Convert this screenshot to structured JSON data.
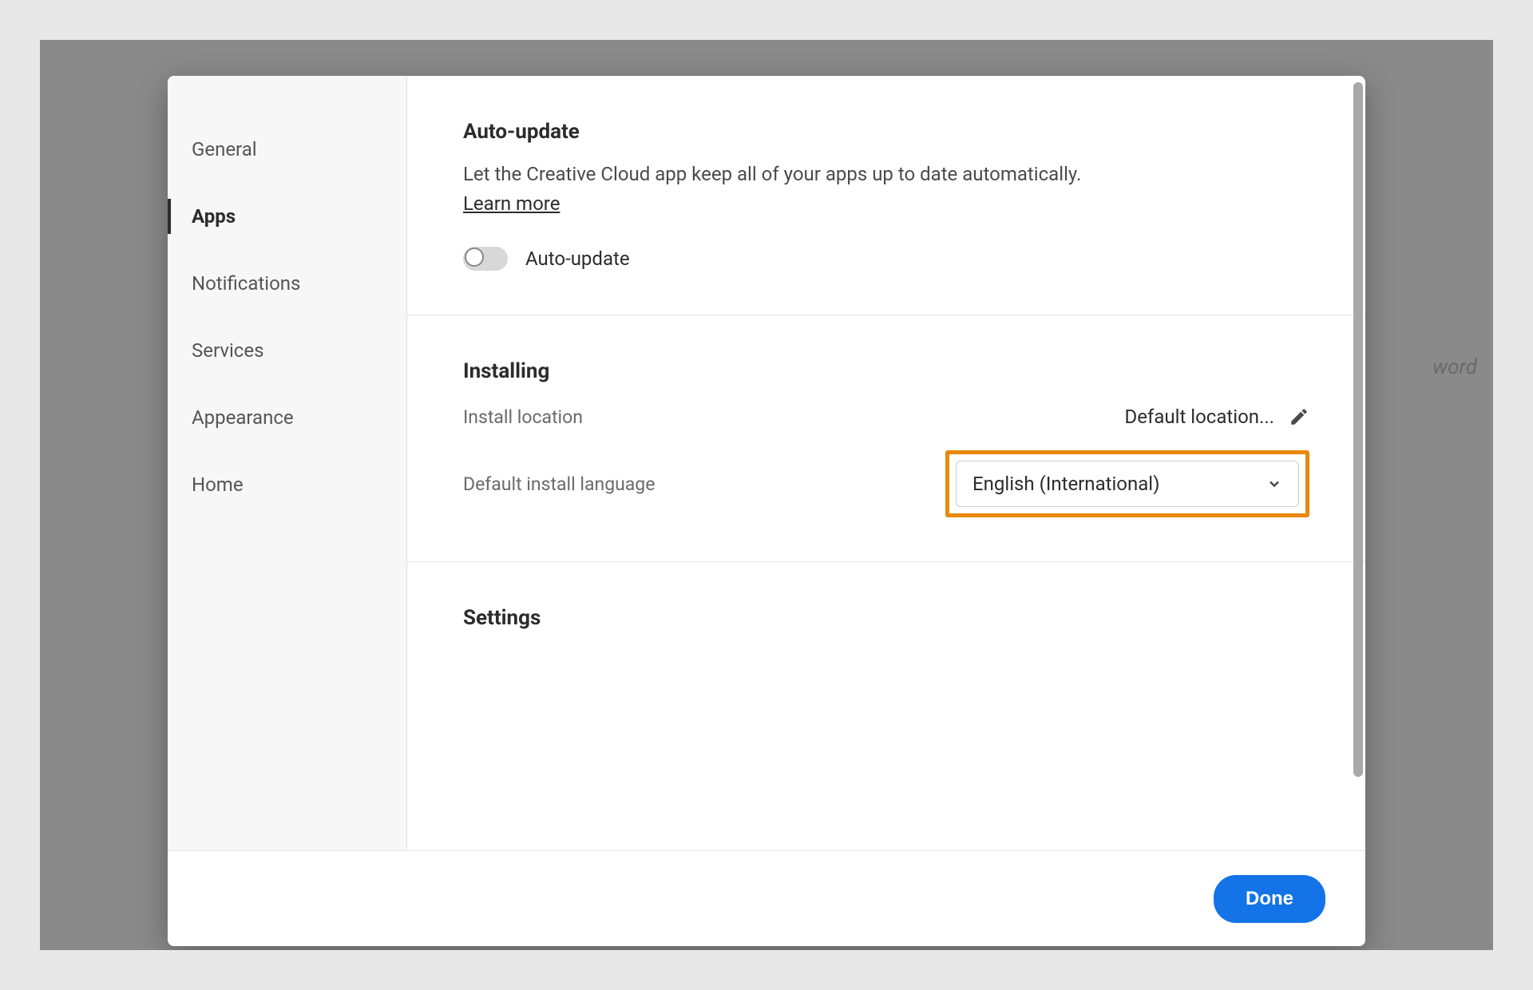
{
  "background": {
    "hint_text": "word"
  },
  "sidebar": {
    "items": [
      {
        "label": "General",
        "active": false
      },
      {
        "label": "Apps",
        "active": true
      },
      {
        "label": "Notifications",
        "active": false
      },
      {
        "label": "Services",
        "active": false
      },
      {
        "label": "Appearance",
        "active": false
      },
      {
        "label": "Home",
        "active": false
      }
    ]
  },
  "sections": {
    "auto_update": {
      "title": "Auto-update",
      "description": "Let the Creative Cloud app keep all of your apps up to date automatically.",
      "learn_more": "Learn more",
      "toggle_label": "Auto-update",
      "toggle_on": false
    },
    "installing": {
      "title": "Installing",
      "location_label": "Install location",
      "location_value": "Default location...",
      "language_label": "Default install language",
      "language_value": "English (International)"
    },
    "settings": {
      "title": "Settings"
    }
  },
  "footer": {
    "done": "Done"
  },
  "highlight_color": "#e8890c",
  "accent_color": "#1473e6"
}
